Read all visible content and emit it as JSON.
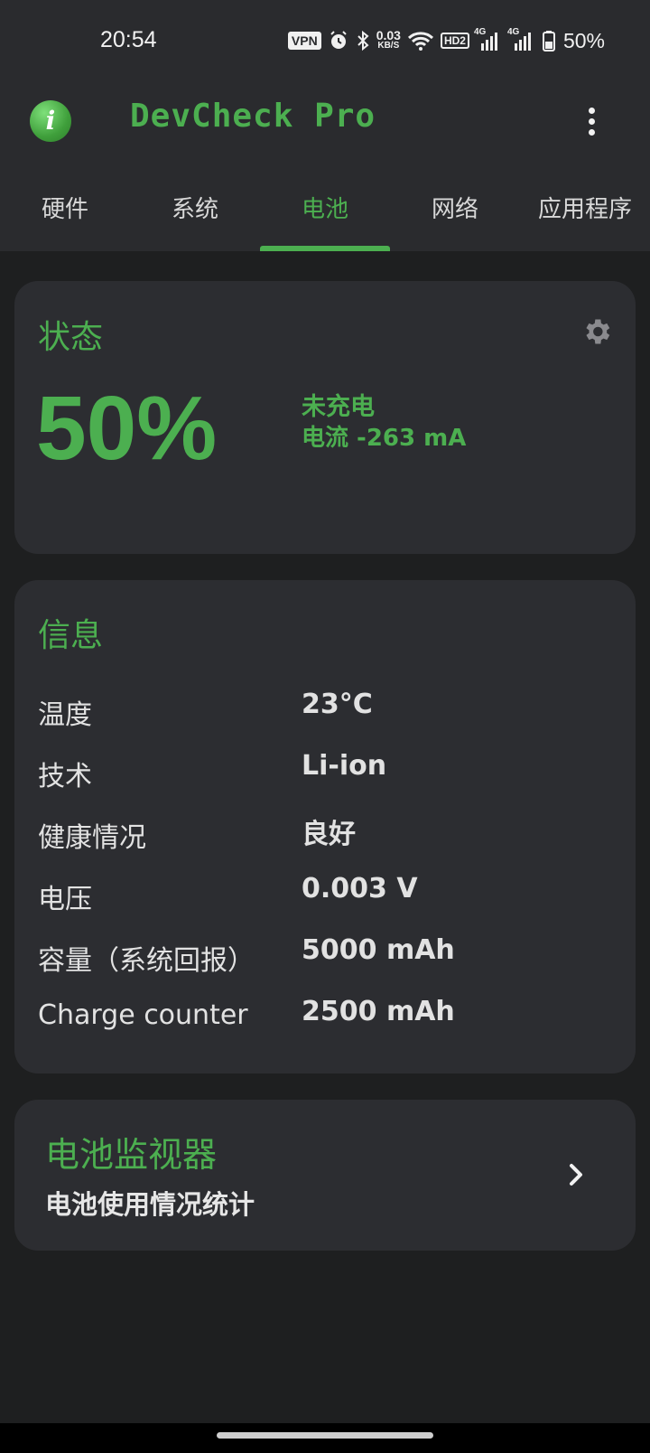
{
  "status_bar": {
    "time": "20:54",
    "vpn": "VPN",
    "net_speed_value": "0.03",
    "net_speed_unit": "KB/S",
    "hd": "HD2",
    "sim1_label": "4G",
    "sim2_label": "4G",
    "battery_percent": "50%"
  },
  "app_bar": {
    "title": "DevCheck Pro",
    "icon": "info-icon"
  },
  "tabs": [
    {
      "label": "硬件",
      "active": false
    },
    {
      "label": "系统",
      "active": false
    },
    {
      "label": "电池",
      "active": true
    },
    {
      "label": "网络",
      "active": false
    },
    {
      "label": "应用程序",
      "active": false
    }
  ],
  "status_card": {
    "title": "状态",
    "percent": "50%",
    "charge_state": "未充电",
    "current": "电流 -263 mA"
  },
  "info_card": {
    "title": "信息",
    "rows": [
      {
        "label": "温度",
        "value": "23°C"
      },
      {
        "label": "技术",
        "value": "Li-ion"
      },
      {
        "label": "健康情况",
        "value": "良好"
      },
      {
        "label": "电压",
        "value": "0.003 V"
      },
      {
        "label": "容量（系统回报）",
        "value": "5000 mAh"
      },
      {
        "label": "Charge counter",
        "value": "2500 mAh"
      }
    ]
  },
  "monitor_card": {
    "title": "电池监视器",
    "subtitle": "电池使用情况统计"
  },
  "colors": {
    "accent": "#4caf50",
    "background": "#1e1f20",
    "card": "#2c2d31",
    "bar": "#2a2b2e"
  }
}
